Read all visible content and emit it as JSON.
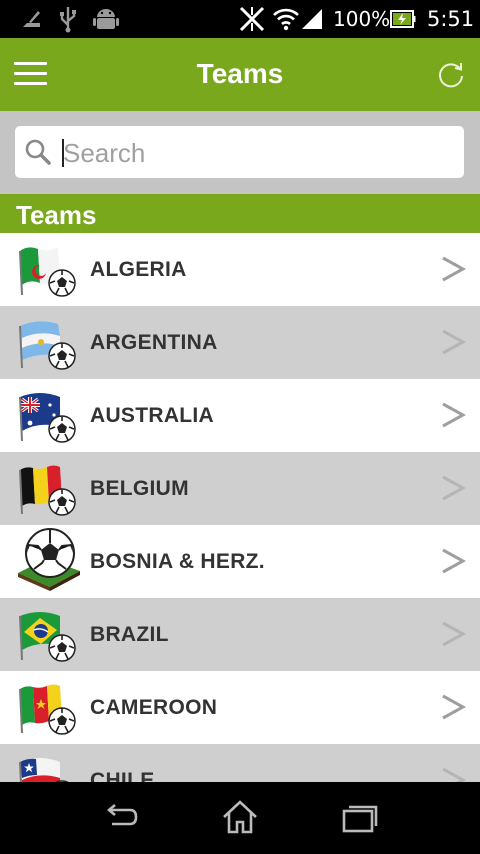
{
  "status_bar": {
    "battery": "100%",
    "time": "5:51",
    "icons": [
      "notification-icon",
      "usb-icon",
      "android-icon",
      "no-sim-icon",
      "wifi-icon",
      "signal-icon",
      "battery-charging-icon"
    ]
  },
  "app_bar": {
    "title": "Teams",
    "menu_icon": "hamburger-menu-icon",
    "refresh_icon": "refresh-icon"
  },
  "search": {
    "placeholder": "Search",
    "value": "",
    "icon": "search-icon"
  },
  "section": {
    "title": "Teams"
  },
  "teams": [
    {
      "name": "ALGERIA",
      "icon": "algeria-flag-ball-icon"
    },
    {
      "name": "ARGENTINA",
      "icon": "argentina-flag-ball-icon"
    },
    {
      "name": "AUSTRALIA",
      "icon": "australia-flag-ball-icon"
    },
    {
      "name": "BELGIUM",
      "icon": "belgium-flag-ball-icon"
    },
    {
      "name": "BOSNIA & HERZ.",
      "icon": "ball-on-grass-icon"
    },
    {
      "name": "BRAZIL",
      "icon": "brazil-flag-ball-icon"
    },
    {
      "name": "CAMEROON",
      "icon": "cameroon-flag-ball-icon"
    },
    {
      "name": "CHILE",
      "icon": "chile-flag-ball-icon"
    }
  ],
  "colors": {
    "accent": "#7aa81c",
    "row_alt": "#cfcfcf",
    "text": "#333333"
  },
  "nav_bar": {
    "icons": [
      "back-icon",
      "home-icon",
      "recent-apps-icon"
    ]
  }
}
